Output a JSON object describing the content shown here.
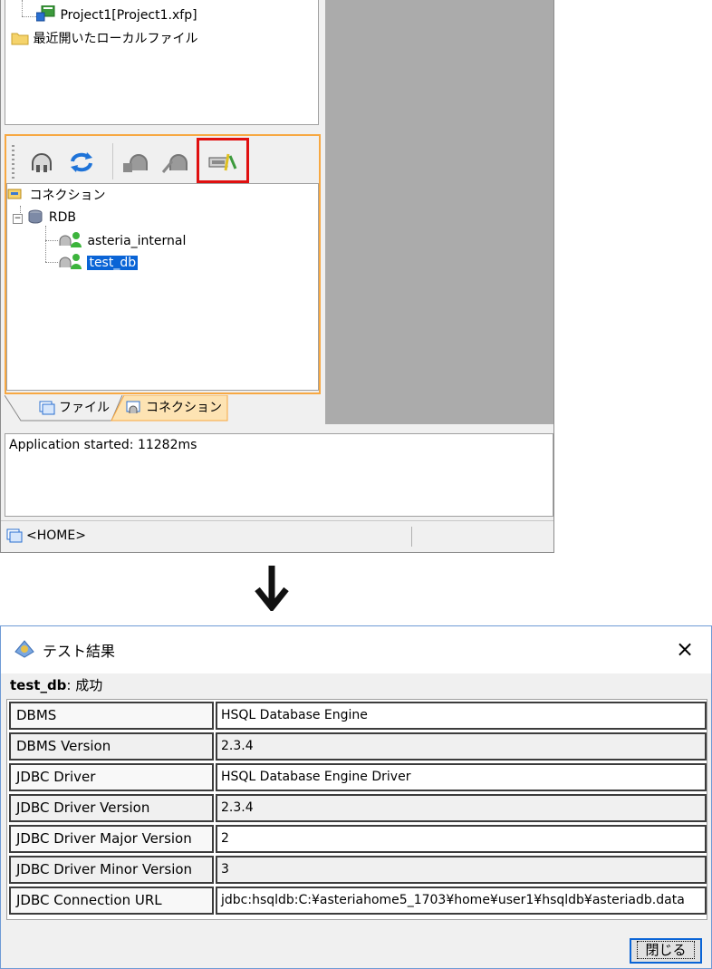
{
  "explorer": {
    "project_label": "Project1[Project1.xfp]",
    "recent_files_label": "最近開いたローカルファイル"
  },
  "connection_tree": {
    "root_label": "コネクション",
    "rdb_label": "RDB",
    "items": [
      "asteria_internal",
      "test_db"
    ],
    "selected": "test_db"
  },
  "tabs": {
    "file_label": "ファイル",
    "connection_label": "コネクション"
  },
  "console": {
    "text": "Application started: 11282ms"
  },
  "status_bar": {
    "text": "<HOME>"
  },
  "dialog": {
    "title": "テスト結果",
    "connection_name": "test_db",
    "result_text": ": 成功",
    "rows": [
      {
        "key": "DBMS",
        "value": "HSQL Database Engine"
      },
      {
        "key": "DBMS Version",
        "value": "2.3.4"
      },
      {
        "key": "JDBC Driver",
        "value": "HSQL Database Engine Driver"
      },
      {
        "key": "JDBC Driver Version",
        "value": "2.3.4"
      },
      {
        "key": "JDBC Driver Major Version",
        "value": "2"
      },
      {
        "key": "JDBC Driver Minor Version",
        "value": "3"
      },
      {
        "key": "JDBC Connection URL",
        "value": "jdbc:hsqldb:C:¥asteriahome5_1703¥home¥user1¥hsqldb¥asteriadb.data"
      }
    ],
    "close_label": "閉じる",
    "close_icon": "×"
  },
  "colors": {
    "highlight_border": "#e01010",
    "panel_border": "#f7a842",
    "selection": "#0a64d6"
  }
}
